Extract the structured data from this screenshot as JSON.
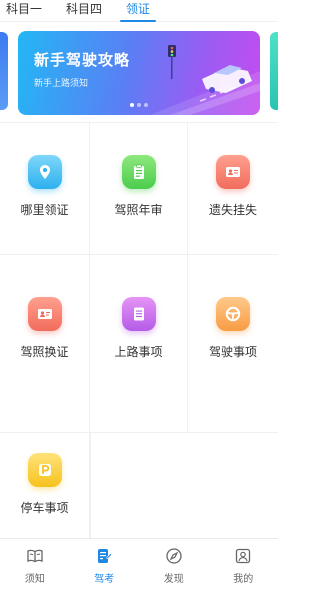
{
  "tabs": [
    {
      "label": "科目一",
      "active": false
    },
    {
      "label": "科目四",
      "active": false
    },
    {
      "label": "领证",
      "active": true
    }
  ],
  "banner": {
    "title": "新手驾驶攻略",
    "subtitle": "新手上路须知",
    "page_count": 3,
    "active_index": 0
  },
  "grid": [
    {
      "label": "哪里领证",
      "icon": "location-pin-icon",
      "color": "#2cb0ef"
    },
    {
      "label": "驾照年审",
      "icon": "clipboard-icon",
      "color": "#4ccd4d"
    },
    {
      "label": "遗失挂失",
      "icon": "id-card-icon",
      "color": "#f26c5c"
    },
    {
      "label": "驾照换证",
      "icon": "license-card-icon",
      "color": "#f26c5c"
    },
    {
      "label": "上路事项",
      "icon": "document-icon",
      "color": "#b55be8"
    },
    {
      "label": "驾驶事项",
      "icon": "steering-wheel-icon",
      "color": "#f89c45"
    },
    {
      "label": "停车事项",
      "icon": "parking-icon",
      "color": "#f6c21d"
    }
  ],
  "bottom_nav": [
    {
      "label": "须知",
      "icon": "book-icon",
      "active": false
    },
    {
      "label": "驾考",
      "icon": "exam-icon",
      "active": true
    },
    {
      "label": "发现",
      "icon": "compass-icon",
      "active": false
    },
    {
      "label": "我的",
      "icon": "profile-icon",
      "active": false
    }
  ],
  "colors": {
    "accent": "#1e88e5",
    "text": "#333333",
    "divider": "#eef0f3"
  }
}
